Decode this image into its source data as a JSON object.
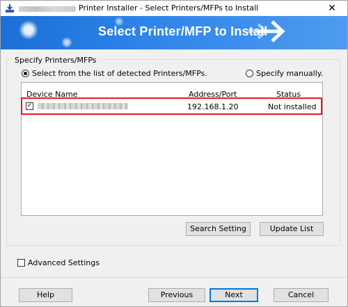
{
  "window": {
    "title": "Printer Installer - Select Printers/MFPs to Install",
    "close_symbol": "✕"
  },
  "banner": {
    "title": "Select Printer/MFP to Install"
  },
  "specify": {
    "group_label": "Specify Printers/MFPs",
    "radio_detected": "Select from the list of detected Printers/MFPs.",
    "radio_manual": "Specify manually.",
    "selected": "detected"
  },
  "device_list": {
    "columns": [
      "Device Name",
      "Address/Port",
      "Status"
    ],
    "rows": [
      {
        "checked": true,
        "address": "192.168.1.20",
        "status": "Not installed"
      }
    ]
  },
  "buttons": {
    "search_setting": "Search Setting",
    "update_list": "Update List",
    "help": "Help",
    "previous": "Previous",
    "next": "Next",
    "cancel": "Cancel"
  },
  "advanced": {
    "label": "Advanced Settings",
    "checked": false
  },
  "colors": {
    "banner": "#2d83e8",
    "highlight": "#e31b23",
    "default_button_border": "#0078d7"
  },
  "icons": [
    "printer-installer-icon",
    "close-icon",
    "arrow-right-icon"
  ]
}
